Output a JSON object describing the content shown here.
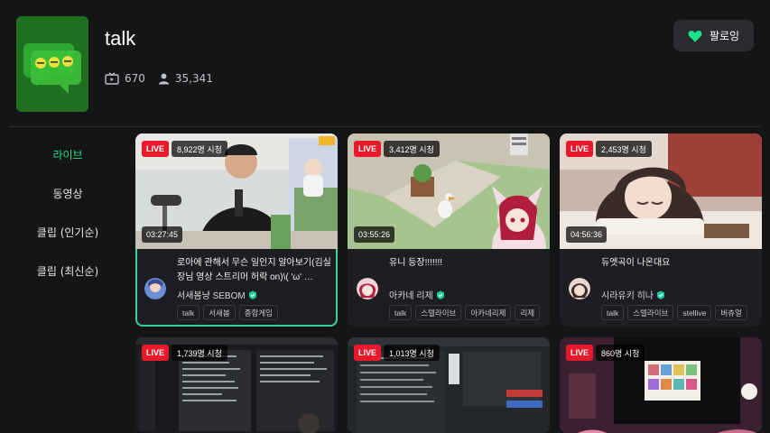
{
  "channel": {
    "name": "talk",
    "video_count": "670",
    "follower_count": "35,341",
    "follow_label": "팔로잉",
    "logo_icon": "chat-bubbles-logo-icon",
    "accent_color": "#19e28a"
  },
  "sidebar": {
    "items": [
      {
        "label": "라이브",
        "active": true
      },
      {
        "label": "동영상",
        "active": false
      },
      {
        "label": "클립 (인기순)",
        "active": false
      },
      {
        "label": "클립 (최신순)",
        "active": false
      }
    ]
  },
  "cards": [
    {
      "live": "LIVE",
      "viewers": "8,922명 시청",
      "duration": "03:27:45",
      "title": "로아에 관해서 무슨 일인지 알아보기(김실장님 영상 스트리머 허락 on)\\( 'ω' …",
      "streamer": "서새봄냥 SEBOM",
      "tags": [
        "talk",
        "서새봄",
        "종합게임"
      ]
    },
    {
      "live": "LIVE",
      "viewers": "3,412명 시청",
      "duration": "03:55:26",
      "title": "유니 등장!!!!!!!",
      "streamer": "아카네 리제",
      "tags": [
        "talk",
        "스텔라이브",
        "아카네리제",
        "리제"
      ]
    },
    {
      "live": "LIVE",
      "viewers": "2,453명 시청",
      "duration": "04:56:36",
      "title": "듀엣곡이 나온대요",
      "streamer": "시라유키 히나",
      "tags": [
        "talk",
        "스텔라이브",
        "stellive",
        "버츄얼"
      ]
    },
    {
      "live": "LIVE",
      "viewers": "1,739명 시청"
    },
    {
      "live": "LIVE",
      "viewers": "1,013명 시청"
    },
    {
      "live": "LIVE",
      "viewers": "860명 시청"
    }
  ]
}
